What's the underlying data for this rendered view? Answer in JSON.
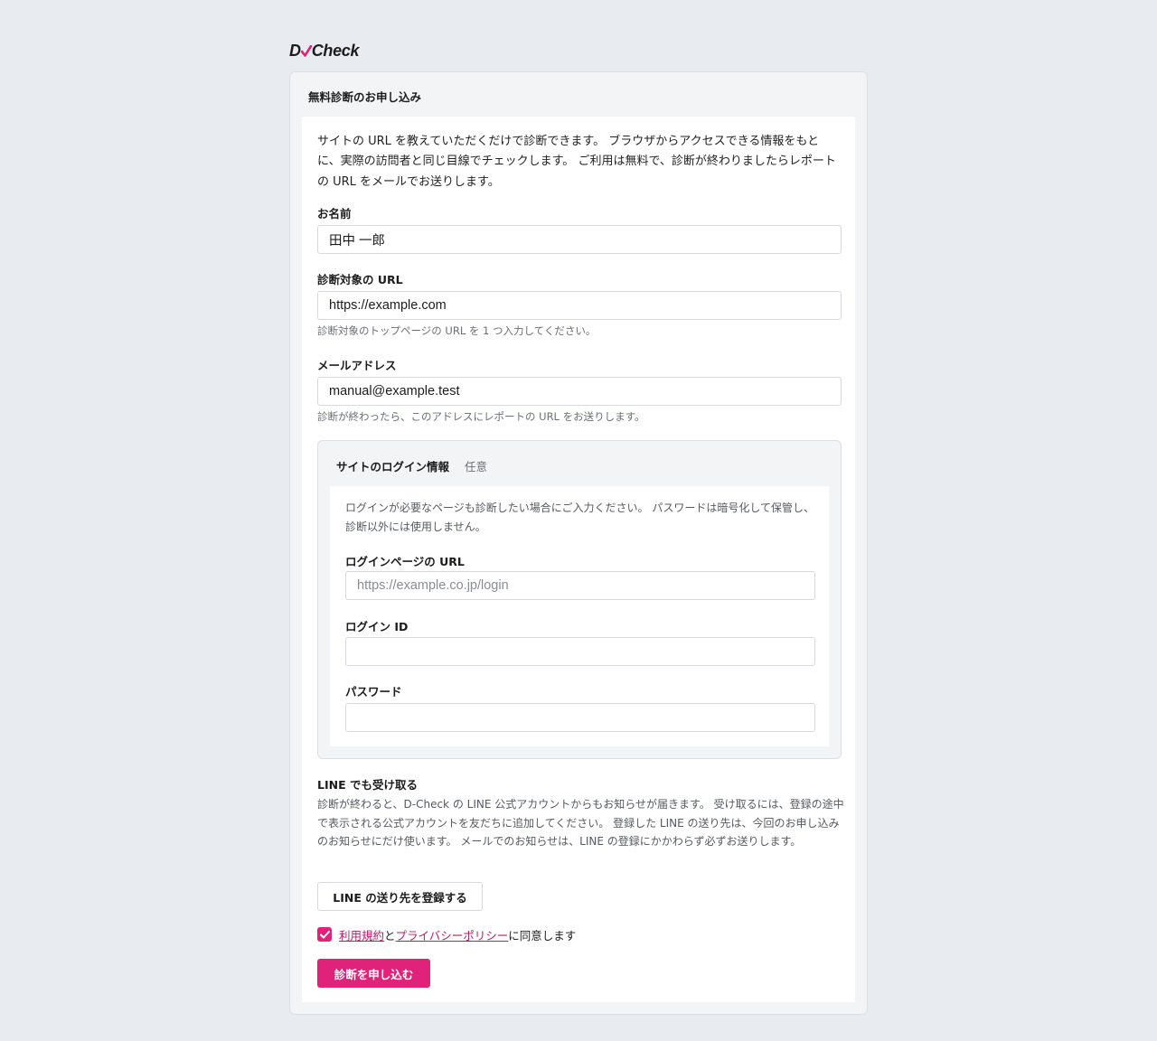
{
  "logo": {
    "text_d": "D",
    "text_check": "Check"
  },
  "colors": {
    "accent": "#e0227a",
    "background": "#e8ebef",
    "panel": "#f3f4f6"
  },
  "form": {
    "title": "無料診断のお申し込み",
    "intro": "サイトの URL を教えていただくだけで診断できます。 ブラウザからアクセスできる情報をもとに、実際の訪問者と同じ目線でチェックします。 ご利用は無料で、診断が終わりましたらレポートの URL をメールでお送りします。",
    "name": {
      "label": "お名前",
      "value": "田中 一郎"
    },
    "url": {
      "label": "診断対象の URL",
      "value": "https://example.com",
      "help": "診断対象のトップページの URL を 1 つ入力してください。"
    },
    "email": {
      "label": "メールアドレス",
      "value": "manual@example.test",
      "help": "診断が終わったら、このアドレスにレポートの URL をお送りします。"
    }
  },
  "login": {
    "title": "サイトのログイン情報",
    "optional": "任意",
    "description": "ログインが必要なページも診断したい場合にご入力ください。 パスワードは暗号化して保管し、診断以外には使用しません。",
    "login_url": {
      "label": "ログインページの URL",
      "placeholder": "https://example.co.jp/login",
      "value": ""
    },
    "login_id": {
      "label": "ログイン ID",
      "value": ""
    },
    "password": {
      "label": "パスワード",
      "value": ""
    }
  },
  "line": {
    "title": "LINE でも受け取る",
    "description": "診断が終わると、D-Check の LINE 公式アカウントからもお知らせが届きます。 受け取るには、登録の途中で表示される公式アカウントを友だちに追加してください。 登録した LINE の送り先は、今回のお申し込みのお知らせにだけ使います。 メールでのお知らせは、LINE の登録にかかわらず必ずお送りします。",
    "button_label": "LINE の送り先を登録する"
  },
  "agreement": {
    "checked": true,
    "terms_link": "利用規約",
    "and": "と",
    "privacy_link": "プライバシーポリシー",
    "suffix": "に同意します"
  },
  "submit_label": "診断を申し込む"
}
